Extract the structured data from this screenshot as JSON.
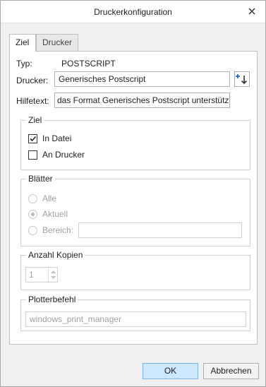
{
  "window": {
    "title": "Druckerkonfiguration"
  },
  "tabs": [
    {
      "label": "Ziel",
      "active": true
    },
    {
      "label": "Drucker",
      "active": false
    }
  ],
  "typ": {
    "label": "Typ:",
    "value": "POSTSCRIPT"
  },
  "drucker": {
    "label": "Drucker:",
    "value": "Generisches Postscript"
  },
  "hilfetext": {
    "label": "Hilfetext:",
    "value": "das Format Generisches Postscript unterstützt."
  },
  "ziel_group": {
    "legend": "Ziel",
    "in_datei": {
      "label": "In Datei",
      "checked": true
    },
    "an_drucker": {
      "label": "An Drucker",
      "checked": false
    }
  },
  "blaetter_group": {
    "legend": "Blätter",
    "alle": "Alle",
    "aktuell": "Aktuell",
    "bereich": "Bereich:",
    "selected": "Aktuell"
  },
  "kopien_group": {
    "legend": "Anzahl Kopien",
    "value": "1"
  },
  "plotter_group": {
    "legend": "Plotterbefehl",
    "value": "windows_print_manager"
  },
  "buttons": {
    "ok": "OK",
    "cancel": "Abbrechen"
  },
  "colors": {
    "ok_bg": "#cce8ff",
    "ok_border": "#7eb4ea",
    "accent_icon": "#1e6fbf"
  }
}
